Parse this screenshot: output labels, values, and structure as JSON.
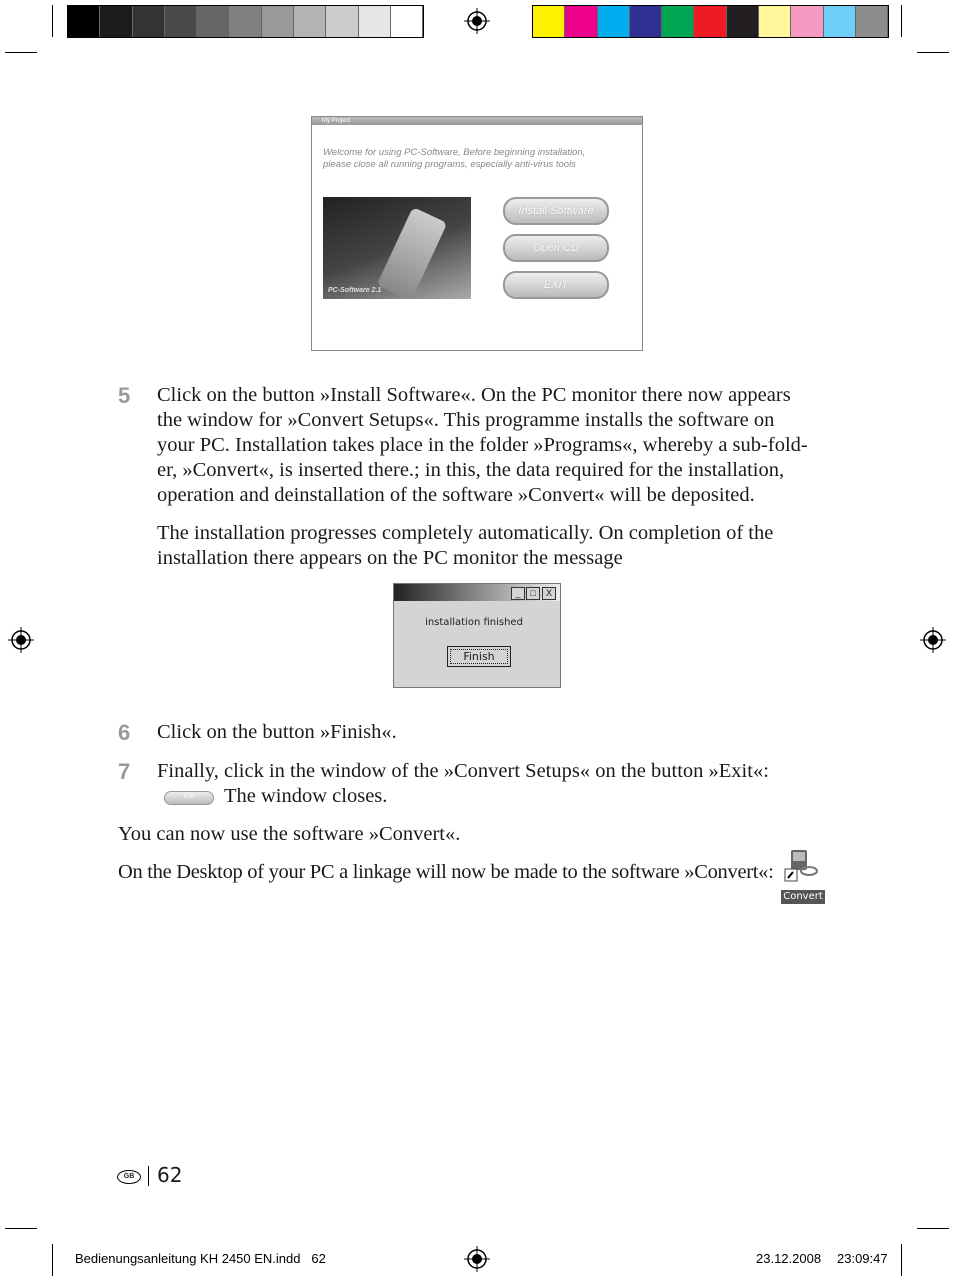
{
  "print_marks": {
    "gray_swatches": [
      "#000000",
      "#1c1c1c",
      "#333333",
      "#4a4a4a",
      "#666666",
      "#808080",
      "#999999",
      "#b3b3b3",
      "#cccccc",
      "#e6e6e6",
      "#ffffff"
    ],
    "color_swatches": [
      "#fff200",
      "#ec008c",
      "#00aeef",
      "#2e3192",
      "#00a651",
      "#ed1c24",
      "#231f20",
      "#fff799",
      "#f49ac1",
      "#6dcff6",
      "#8c8c8c"
    ]
  },
  "installer_window": {
    "title": "My Project",
    "welcome_line1": "Welcome for using PC-Software, Before beginning installation,",
    "welcome_line2": "please close all running programs, especially anti-virus tools",
    "image_caption": "PC-Software 2.1",
    "buttons": [
      "Install Software",
      "Open CD",
      "EXIT"
    ]
  },
  "steps": [
    {
      "number": "5",
      "lines": [
        "Click on the button »Install Software«. On the PC monitor there now appears",
        "the window for »Convert Setups«. This programme installs the software on",
        "your PC. Installation takes place in the folder »Programs«, whereby a sub-fold-",
        "er, »Convert«, is inserted there.; in this, the data required for the installation,",
        "operation and deinstallation of the software »Convert« will be deposited."
      ],
      "extra_lines": [
        "The installation progresses completely automatically. On completion of the",
        "installation there appears on the PC monitor the message"
      ]
    },
    {
      "number": "6",
      "lines": [
        "Click on the button »Finish«."
      ]
    },
    {
      "number": "7",
      "lines": [
        "Finally, click in the window of the »Convert Setups« on the button »Exit«:",
        "The window closes."
      ]
    }
  ],
  "finish_dialog": {
    "message": "installation finished",
    "button": "Finish",
    "controls": [
      "_",
      "□",
      "X"
    ]
  },
  "exit_button_inline": "Exit",
  "closing": [
    "You can now use the software »Convert«.",
    "On the Desktop of your PC a linkage will now be made to the software »Convert«:"
  ],
  "desktop_icon_label": "Convert",
  "page_footer": {
    "country": "GB",
    "page_number": "62"
  },
  "slug": {
    "file": "Bedienungsanleitung KH 2450 EN.indd   62",
    "date": "23.12.2008",
    "time": "23:09:47"
  }
}
